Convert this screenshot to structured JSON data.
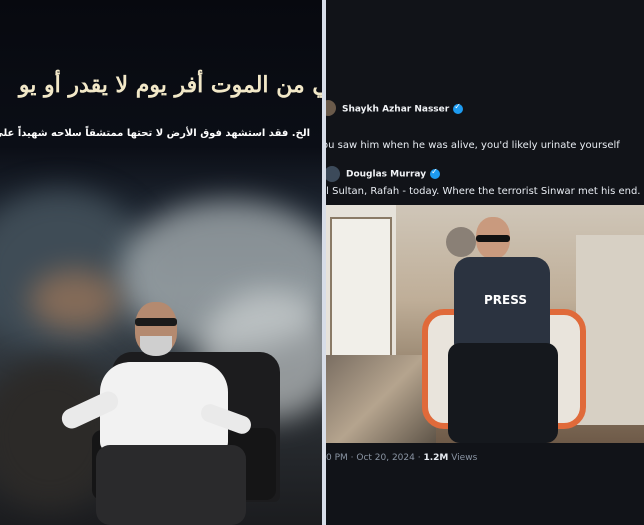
{
  "left_poster": {
    "arabic_title": "يومي من الموت أفر   يوم لا يقدر أو يو",
    "arabic_subtitle": "الخ. فقد استشهد فوق الأرض لا تحتها ممتشقاً سلاحه شهيداً على ما"
  },
  "right_post": {
    "top_author": "Shaykh Azhar Nasser",
    "top_text": "ou saw him when he was alive, you'd likely urinate yourself",
    "author": "Douglas Murray",
    "text": "el Sultan, Rafah - today. Where the terrorist Sinwar met his end.",
    "vest_label": "PRESS",
    "meta_prefix": "0 PM · Oct 20, 2024 · ",
    "views_count": "1.2M",
    "views_label": " Views"
  },
  "colors": {
    "accent": "#1d9bf0",
    "background": "#111318"
  },
  "icons": [
    "verified-badge-icon",
    "verified-badge-icon"
  ]
}
